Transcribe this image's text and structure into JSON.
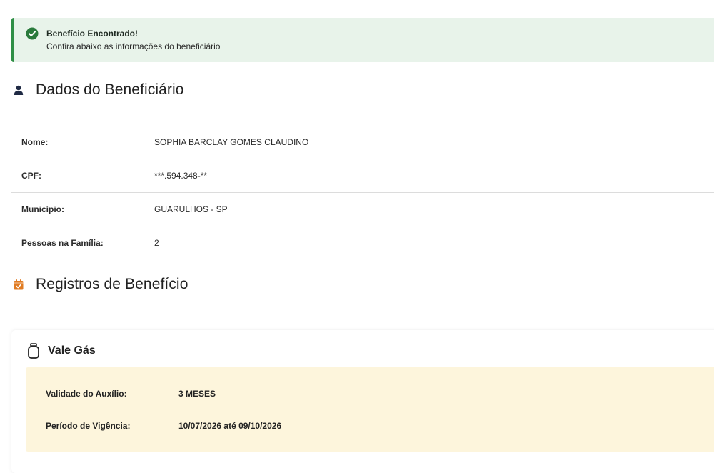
{
  "alert": {
    "title": "Benefício Encontrado!",
    "message": "Confira abaixo as informações do beneficiário",
    "icon": "check-circle-icon",
    "color": "#2f8f46"
  },
  "beneficiary": {
    "heading": "Dados do Beneficiário",
    "icon": "user-icon",
    "rows": [
      {
        "label": "Nome:",
        "value": "SOPHIA BARCLAY GOMES CLAUDINO"
      },
      {
        "label": "CPF:",
        "value": "***.594.348-**"
      },
      {
        "label": "Município:",
        "value": "GUARULHOS - SP"
      },
      {
        "label": "Pessoas na Família:",
        "value": "2"
      }
    ]
  },
  "records": {
    "heading": "Registros de Benefício",
    "icon": "calendar-check-icon",
    "icon_color": "#e07b22",
    "card": {
      "title": "Vale Gás",
      "icon": "gas-cylinder-icon",
      "details": [
        {
          "label": "Validade do Auxílio:",
          "value": "3 MESES"
        },
        {
          "label": "Período de Vigência:",
          "value": "10/07/2026 até 09/10/2026"
        }
      ]
    }
  }
}
